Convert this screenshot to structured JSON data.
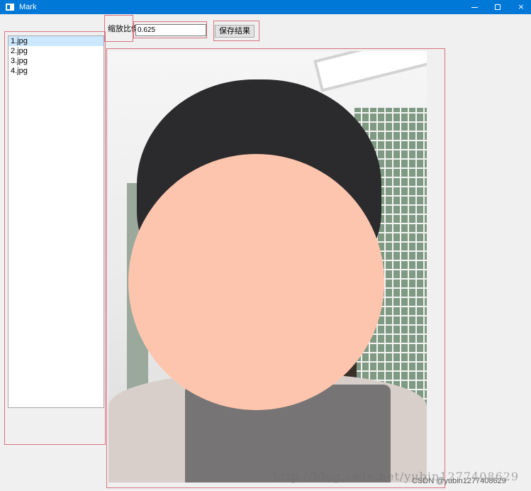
{
  "window": {
    "title": "Mark",
    "controls": {
      "minimize": "minimize",
      "maximize": "maximize",
      "close": "×"
    }
  },
  "file_list": {
    "items": [
      {
        "label": "1.jpg",
        "selected": true
      },
      {
        "label": "2.jpg",
        "selected": false
      },
      {
        "label": "3.jpg",
        "selected": false
      },
      {
        "label": "4.jpg",
        "selected": false
      }
    ]
  },
  "toolbar": {
    "scale_label": "缩放比例",
    "scale_value": "0.625",
    "save_label": "保存结果"
  },
  "colors": {
    "titlebar": "#0078d7",
    "selection": "#cce8ff",
    "annotation_outline": "#d9737f",
    "face_cover": "#fec5ae"
  },
  "watermarks": {
    "url": "http://blog.csdn.net/yubin1277408629",
    "csdn": "CSDN @yubin1277408629"
  }
}
